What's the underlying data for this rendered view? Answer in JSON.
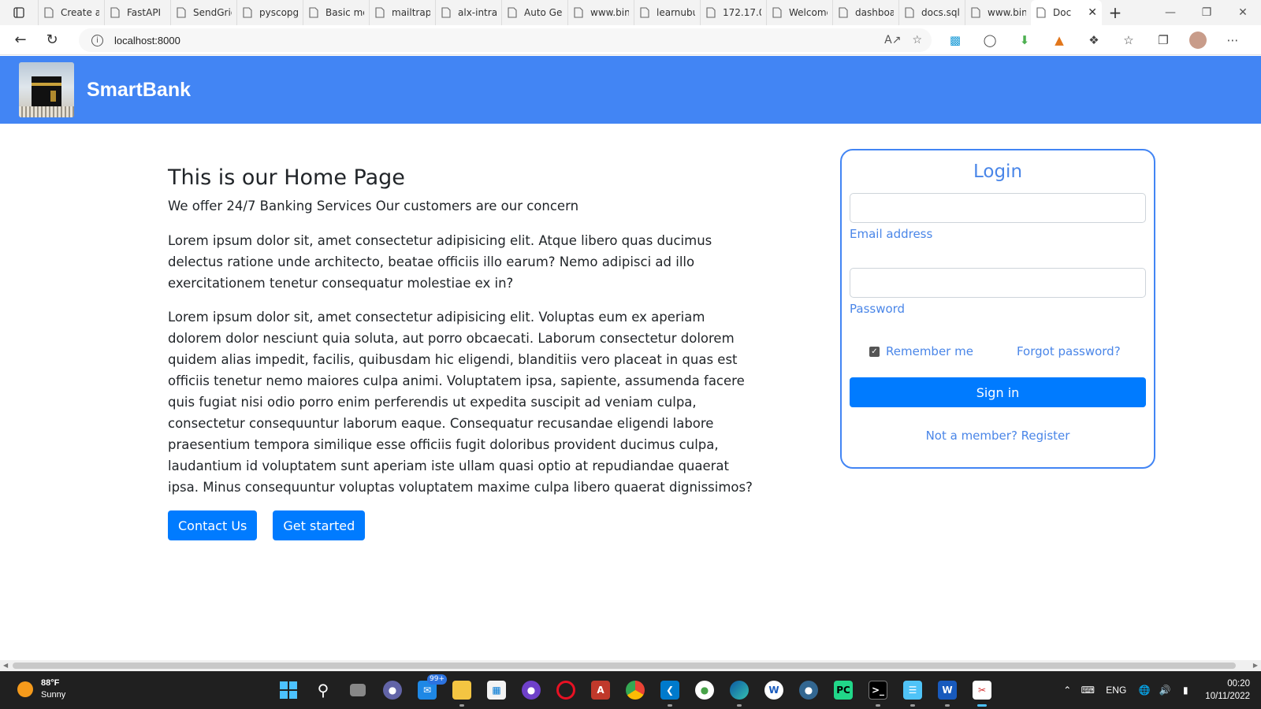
{
  "browser": {
    "tabs": [
      {
        "label": "Create a",
        "icon": "doc-icon"
      },
      {
        "label": "FastAPI",
        "icon": "fastapi-icon"
      },
      {
        "label": "SendGrid",
        "icon": "sendgrid-icon"
      },
      {
        "label": "pyscopg",
        "icon": "search-icon"
      },
      {
        "label": "Basic mo",
        "icon": "basic-icon"
      },
      {
        "label": "mailtrap",
        "icon": "mailtrap-icon"
      },
      {
        "label": "alx-intra",
        "icon": "alx-icon"
      },
      {
        "label": "Auto Ge",
        "icon": "doc-icon"
      },
      {
        "label": "www.bin",
        "icon": "bing-icon"
      },
      {
        "label": "learnubu",
        "icon": "ubuntu-icon"
      },
      {
        "label": "172.17.0",
        "icon": "doc-icon"
      },
      {
        "label": "Welcome",
        "icon": "welcome-icon"
      },
      {
        "label": "dashboa",
        "icon": "heroku-icon"
      },
      {
        "label": "docs.sql",
        "icon": "docs-icon"
      },
      {
        "label": "www.bin",
        "icon": "doc-icon"
      },
      {
        "label": "Doc",
        "icon": "doc-icon",
        "active": true
      }
    ],
    "url": "localhost:8000"
  },
  "site": {
    "brand": "SmartBank"
  },
  "main": {
    "title": "This is our Home Page",
    "lead": "We offer 24/7 Banking Services Our customers are our concern",
    "paragraph1": "Lorem ipsum dolor sit, amet consectetur adipisicing elit. Atque libero quas ducimus delectus ratione unde architecto, beatae officiis illo earum? Nemo adipisci ad illo exercitationem tenetur consequatur molestiae ex in?",
    "paragraph2": "Lorem ipsum dolor sit, amet consectetur adipisicing elit. Voluptas eum ex aperiam dolorem dolor nesciunt quia soluta, aut porro obcaecati. Laborum consectetur dolorem quidem alias impedit, facilis, quibusdam hic eligendi, blanditiis vero placeat in quas est officiis tenetur nemo maiores culpa animi. Voluptatem ipsa, sapiente, assumenda facere quis fugiat nisi odio porro enim perferendis ut expedita suscipit ad veniam culpa, consectetur consequuntur laborum eaque. Consequatur recusandae eligendi labore praesentium tempora similique esse officiis fugit doloribus provident ducimus culpa, laudantium id voluptatem sunt aperiam iste ullam quasi optio at repudiandae quaerat ipsa. Minus consequuntur voluptas voluptatem maxime culpa libero quaerat dignissimos?",
    "contact_label": "Contact Us",
    "started_label": "Get started"
  },
  "login": {
    "title": "Login",
    "email_value": "",
    "email_label": "Email address",
    "password_value": "",
    "password_label": "Password",
    "remember_label": "Remember me",
    "remember_checked": true,
    "forgot_label": "Forgot password?",
    "signin_label": "Sign in",
    "register_label": "Not a member? Register"
  },
  "taskbar": {
    "weather_temp": "88°F",
    "weather_desc": "Sunny",
    "mail_badge": "99+",
    "language": "ENG",
    "time": "00:20",
    "date": "10/11/2022"
  },
  "colors": {
    "header": "#4285f4",
    "button": "#007bff",
    "login_text": "#4a86e8"
  }
}
